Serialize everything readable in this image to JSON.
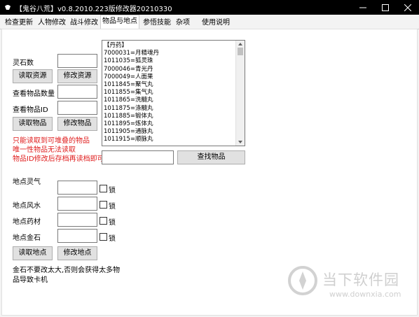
{
  "window": {
    "title": "【鬼谷八荒】v0.8.2010.223版修改器20210330"
  },
  "tabs": [
    {
      "label": "检查更新"
    },
    {
      "label": "人物修改"
    },
    {
      "label": "战斗修改"
    },
    {
      "label": "物品与地点"
    },
    {
      "label": "参悟技能"
    },
    {
      "label": "杂项"
    },
    {
      "label": "使用说明"
    }
  ],
  "active_tab": "物品与地点",
  "items": {
    "spirit_stone_label": "灵石数",
    "spirit_stone_value": "",
    "read_resource_button": "读取资源",
    "modify_resource_button": "修改资源",
    "item_count_label": "查看物品数量",
    "item_count_value": "",
    "item_id_label": "查看物品ID",
    "item_id_value": "",
    "read_item_button": "读取物品",
    "modify_item_button": "修改物品",
    "note_lines": [
      "只能读取到可堆叠的物品",
      "唯一性物品无法读取",
      "物品ID修改后存档再读档即可"
    ],
    "search_value": "",
    "search_button": "查找物品",
    "list": [
      "【丹药】",
      "7000031=月精魂丹",
      "1011035=狐灵珠",
      "7000046=青光丹",
      "7000049=人面果",
      "1011845=聚气丸",
      "1011855=集气丸",
      "1011865=洗髓丸",
      "1011875=涤髓丸",
      "1011885=锻体丸",
      "1011895=炼体丸",
      "1011905=通脉丸",
      "1011915=顺脉丸"
    ]
  },
  "locations": {
    "fields": [
      {
        "label": "地点灵气",
        "value": "",
        "lock_label": "锁"
      },
      {
        "label": "地点风水",
        "value": "",
        "lock_label": "锁"
      },
      {
        "label": "地点药材",
        "value": "",
        "lock_label": "锁"
      },
      {
        "label": "地点金石",
        "value": "",
        "lock_label": "锁"
      }
    ],
    "read_location_button": "读取地点",
    "modify_location_button": "修改地点",
    "warning_lines": [
      "金石不要改太大,否则会获得太多物",
      "品导致卡机"
    ]
  },
  "watermark": {
    "name": "当下软件园",
    "url": "www.downxia.com"
  },
  "colors": {
    "warning": "#e02020",
    "titlebar": "#000000",
    "button": "#e1e1e1"
  }
}
